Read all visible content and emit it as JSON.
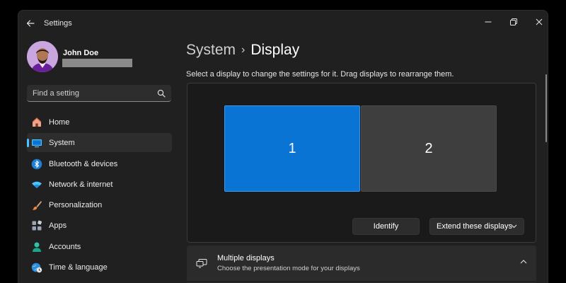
{
  "window": {
    "title": "Settings"
  },
  "user": {
    "name": "John Doe"
  },
  "search": {
    "placeholder": "Find a setting"
  },
  "sidebar": {
    "items": [
      {
        "label": "Home",
        "icon": "home-icon"
      },
      {
        "label": "System",
        "icon": "system-icon",
        "active": true
      },
      {
        "label": "Bluetooth & devices",
        "icon": "bluetooth-icon"
      },
      {
        "label": "Network & internet",
        "icon": "wifi-icon"
      },
      {
        "label": "Personalization",
        "icon": "brush-icon"
      },
      {
        "label": "Apps",
        "icon": "apps-icon"
      },
      {
        "label": "Accounts",
        "icon": "person-icon"
      },
      {
        "label": "Time & language",
        "icon": "globe-clock-icon"
      }
    ]
  },
  "header": {
    "parent": "System",
    "current": "Display"
  },
  "display": {
    "instructions": "Select a display to change the settings for it. Drag displays to rearrange them.",
    "monitors": [
      "1",
      "2"
    ],
    "identify_label": "Identify",
    "mode_label": "Extend these displays"
  },
  "multiple_displays": {
    "title": "Multiple displays",
    "subtitle": "Choose the presentation mode for your displays"
  },
  "colors": {
    "accent": "#0a74d4",
    "accent_light": "#4cc2ff",
    "background": "#202020",
    "panel": "#2b2b2b"
  }
}
